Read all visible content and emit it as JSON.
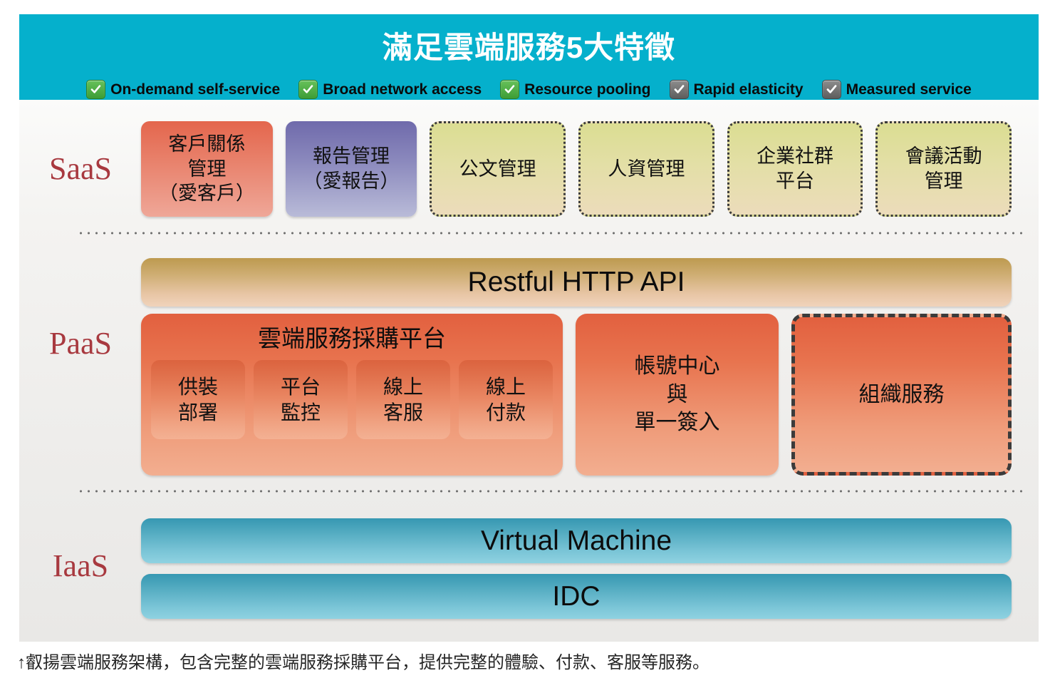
{
  "banner": {
    "title": "滿足雲端服務5大特徵",
    "bg_color": "#05b0cc",
    "features": [
      {
        "label": "On-demand self-service",
        "state": "checked-green",
        "icon": "checkbox-checked-icon"
      },
      {
        "label": "Broad network access",
        "state": "checked-green",
        "icon": "checkbox-checked-icon"
      },
      {
        "label": "Resource pooling",
        "state": "checked-green",
        "icon": "checkbox-checked-icon"
      },
      {
        "label": "Rapid elasticity",
        "state": "checked-gray",
        "icon": "checkbox-checked-icon"
      },
      {
        "label": "Measured service",
        "state": "checked-gray",
        "icon": "checkbox-checked-icon"
      }
    ]
  },
  "tiers": {
    "saas": {
      "label": "SaaS",
      "color": "#a8393f"
    },
    "paas": {
      "label": "PaaS",
      "color": "#a8393f"
    },
    "iaas": {
      "label": "IaaS",
      "color": "#a8393f"
    }
  },
  "saas": {
    "cards": [
      {
        "text": "客戶關係\n管理\n（愛客戶）",
        "style": "solid-red"
      },
      {
        "text": "報告管理\n（愛報告）",
        "style": "solid-purple"
      },
      {
        "text": "公文管理",
        "style": "dotted-olive"
      },
      {
        "text": "人資管理",
        "style": "dotted-olive"
      },
      {
        "text": "企業社群\n平台",
        "style": "dotted-olive"
      },
      {
        "text": "會議活動\n管理",
        "style": "dotted-olive"
      }
    ]
  },
  "paas": {
    "api_bar": {
      "label": "Restful HTTP API",
      "color": "#cfae74"
    },
    "platform": {
      "title": "雲端服務採購平台",
      "color": "#e8744f",
      "sub_items": [
        {
          "text": "供裝\n部署"
        },
        {
          "text": "平台\n監控"
        },
        {
          "text": "線上\n客服"
        },
        {
          "text": "線上\n付款"
        }
      ]
    },
    "account_center": {
      "text": "帳號中心\n與\n單一簽入",
      "style": "solid-orange"
    },
    "org_service": {
      "text": "組織服務",
      "style": "dashed-orange"
    }
  },
  "iaas": {
    "bars": [
      {
        "label": "Virtual Machine",
        "color": "#52aac0"
      },
      {
        "label": "IDC",
        "color": "#52aac0"
      }
    ]
  },
  "caption": {
    "text": "↑叡揚雲端服務架構，包含完整的雲端服務採購平台，提供完整的體驗、付款、客服等服務。"
  }
}
